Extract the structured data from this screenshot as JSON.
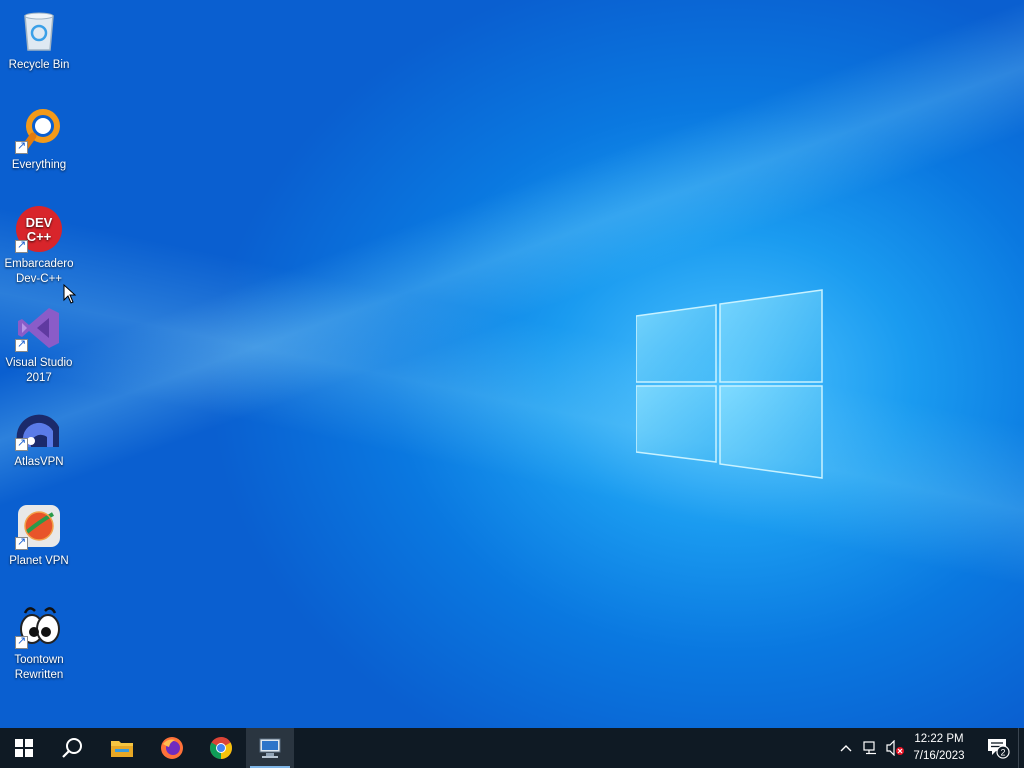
{
  "desktop": {
    "icons": [
      {
        "label": "Recycle Bin",
        "icon": "recycle-bin-icon"
      },
      {
        "label": "Everything",
        "icon": "everything-search-icon"
      },
      {
        "label": "Embarcadero Dev-C++",
        "icon": "devcpp-icon",
        "badge": "DEV C++"
      },
      {
        "label": "Visual Studio 2017",
        "icon": "visual-studio-icon"
      },
      {
        "label": "AtlasVPN",
        "icon": "atlasvpn-icon"
      },
      {
        "label": "Planet VPN",
        "icon": "planet-vpn-icon"
      },
      {
        "label": "Toontown Rewritten",
        "icon": "toontown-icon"
      }
    ]
  },
  "taskbar": {
    "start": "windows-start-icon",
    "search": "search-icon",
    "pinned": [
      "file-explorer-icon",
      "firefox-icon",
      "chrome-icon",
      "remote-desktop-icon"
    ],
    "tray": {
      "chevron": "show-hidden-icons",
      "network": "network-icon",
      "volume": "volume-muted-icon",
      "time": "12:22 PM",
      "date": "7/16/2023",
      "notifications_count": "2"
    }
  },
  "colors": {
    "taskbar": "#0f1a24",
    "wallpaper_accent": "#1a9bf0"
  }
}
